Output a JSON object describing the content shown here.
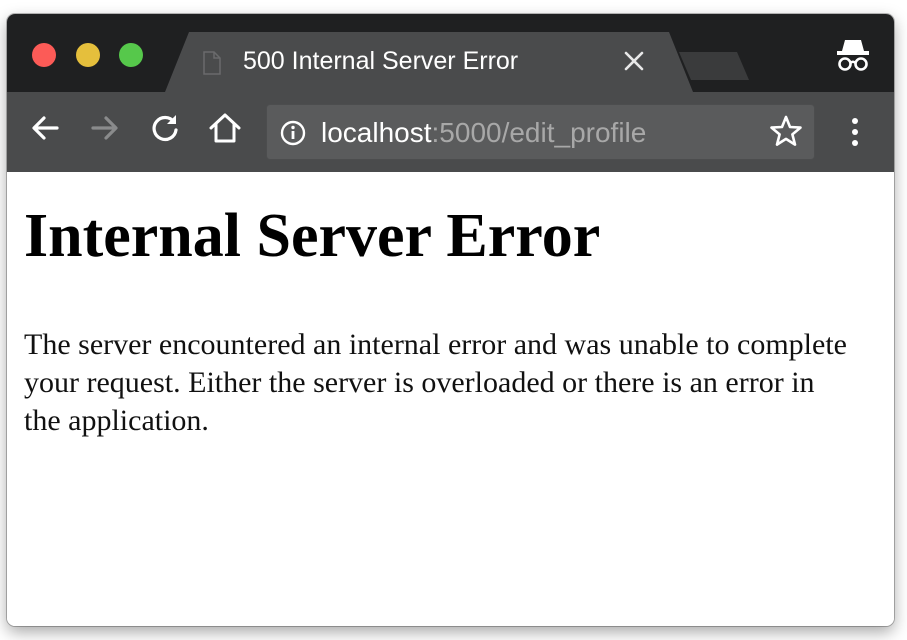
{
  "browser": {
    "tab": {
      "title": "500 Internal Server Error"
    },
    "address_bar": {
      "host": "localhost",
      "path": ":5000/edit_profile"
    },
    "icons": {
      "tab": "document-icon",
      "tab_close": "close-icon",
      "incognito": "incognito-icon",
      "back": "back-arrow-icon",
      "forward": "forward-arrow-icon",
      "reload": "reload-icon",
      "home": "home-icon",
      "site_info": "info-icon",
      "bookmark": "star-icon",
      "menu": "kebab-menu-icon"
    },
    "colors": {
      "tab_strip": "#1f2021",
      "toolbar": "#4a4b4c",
      "traffic_close": "#fc5b57",
      "traffic_minimize": "#e5bf3c",
      "traffic_maximize": "#56c84b"
    }
  },
  "page": {
    "heading": "Internal Server Error",
    "message": "The server encountered an internal error and was unable to complete your request. Either the server is overloaded or there is an error in the application."
  }
}
